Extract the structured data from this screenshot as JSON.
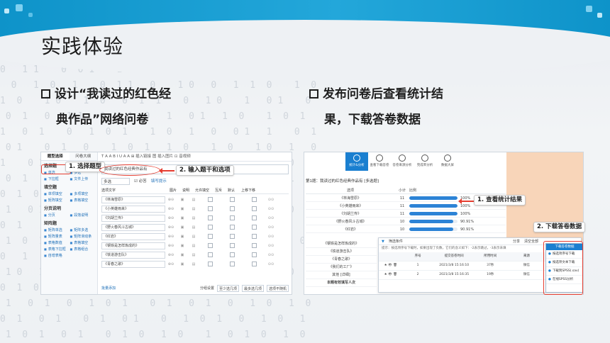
{
  "slide": {
    "title": "实践体验",
    "bullet_left_line1": "设计“我读过的红色经",
    "bullet_left_line2": "典作品”网络问卷",
    "bullet_right_line1": "发布问卷后查看统计结",
    "bullet_right_line2": "果，下载答卷数据"
  },
  "colors": {
    "band": "#0e93c9",
    "accent": "#e53d30",
    "link": "#1e6fb8",
    "button": "#1a7fd0",
    "peach": "#f8d5b9"
  },
  "design_panel": {
    "tab1": "题型选择",
    "tab2": "问卷大纲",
    "callout": "1. 选择题型",
    "callout2": "2. 输入题干和选项",
    "sections": [
      {
        "title": "选择题",
        "items": [
          "单选",
          "多选",
          "下拉框",
          "文件上传"
        ]
      },
      {
        "title": "填空题",
        "items": [
          "单项填空",
          "多项填空",
          "矩阵填空",
          "表格填空"
        ]
      },
      {
        "title": "分页说明",
        "items": [
          "分页",
          "段落说明"
        ]
      },
      {
        "title": "矩阵题",
        "items": [
          "矩阵单选",
          "矩阵多选",
          "矩阵量表",
          "矩阵滑动条",
          "表格数值",
          "表格填空",
          "表格下拉框",
          "表格组合",
          "自增表格"
        ]
      }
    ],
    "toolbar": "T  A  A  B  I  U  A  A  ⊞ 插入链接  图 插入图片  ⊡ 音视频",
    "question_title": "我读过的红色经典作品有",
    "type_select": "多选",
    "required_label": "必答",
    "hint_label": "填写提示",
    "headers": [
      "选项文字",
      "图片",
      "说明",
      "允许填空",
      "互斥",
      "默认",
      "上移下移"
    ],
    "options": [
      "《林海雪原》",
      "《小英雄雨来》",
      "《刘胡兰传》",
      "《野火春风斗古城》",
      "《红岩》",
      "《钢铁是怎样炼成的》",
      "《铁道游击队》",
      "《青春之歌》"
    ],
    "footer_link": "批量添加",
    "footer_items": [
      "分组设置",
      "至少选几项",
      "最多选几项",
      "选项不随机"
    ]
  },
  "stats_panel": {
    "callout": "1. 查看统计结果",
    "callout2": "2. 下载答卷数据",
    "tabs": [
      "统计&分析",
      "查看下载答卷",
      "答卷来源分析",
      "完成率分析",
      "数据大屏"
    ],
    "question_line": "第1题：我读过的红色经典作品有 [多选题]",
    "headers": [
      "选项",
      "小计",
      "比例"
    ],
    "rows": [
      {
        "option": "《林海雪原》",
        "count": "11",
        "pct": "100%",
        "ratio": 1.0
      },
      {
        "option": "《小英雄雨来》",
        "count": "11",
        "pct": "100%",
        "ratio": 1.0
      },
      {
        "option": "《刘胡兰传》",
        "count": "11",
        "pct": "100%",
        "ratio": 1.0
      },
      {
        "option": "《野火春风斗古城》",
        "count": "10",
        "pct": "90.91%",
        "ratio": 0.9091
      },
      {
        "option": "《红岩》",
        "count": "10",
        "pct": "90.91%",
        "ratio": 0.9091
      }
    ],
    "lower_options": [
      "《钢铁是怎样炼成的》",
      "《铁道游击队》",
      "《青春之歌》",
      "《我们的工厂》",
      "其他 [详细]",
      "本题有效填写人次"
    ],
    "filter": {
      "title": "筛选条件",
      "share": "分享",
      "clear": "清空全部",
      "note": "提示：按选项序号下载时，如果出现了负数，它们的含义如下：-2表示跳过，-3表示未填",
      "headers": [
        "序号",
        "提交答卷时间",
        "所用时间",
        "来源",
        "来源详情"
      ],
      "rows": [
        {
          "no": "1",
          "time": "2021/3/8 15:16:10",
          "dur": "37秒",
          "src": "微信",
          "detail": "N/A"
        },
        {
          "no": "2",
          "time": "2021/3/8 15:16:35",
          "dur": "19秒",
          "src": "微信",
          "detail": "N/A"
        }
      ]
    },
    "download_button": "下载答卷数据",
    "download_items": [
      "按选项序号下载",
      "按选项文本下载",
      "下载到SPSS(.sav)",
      "在线SPSS分析"
    ]
  }
}
